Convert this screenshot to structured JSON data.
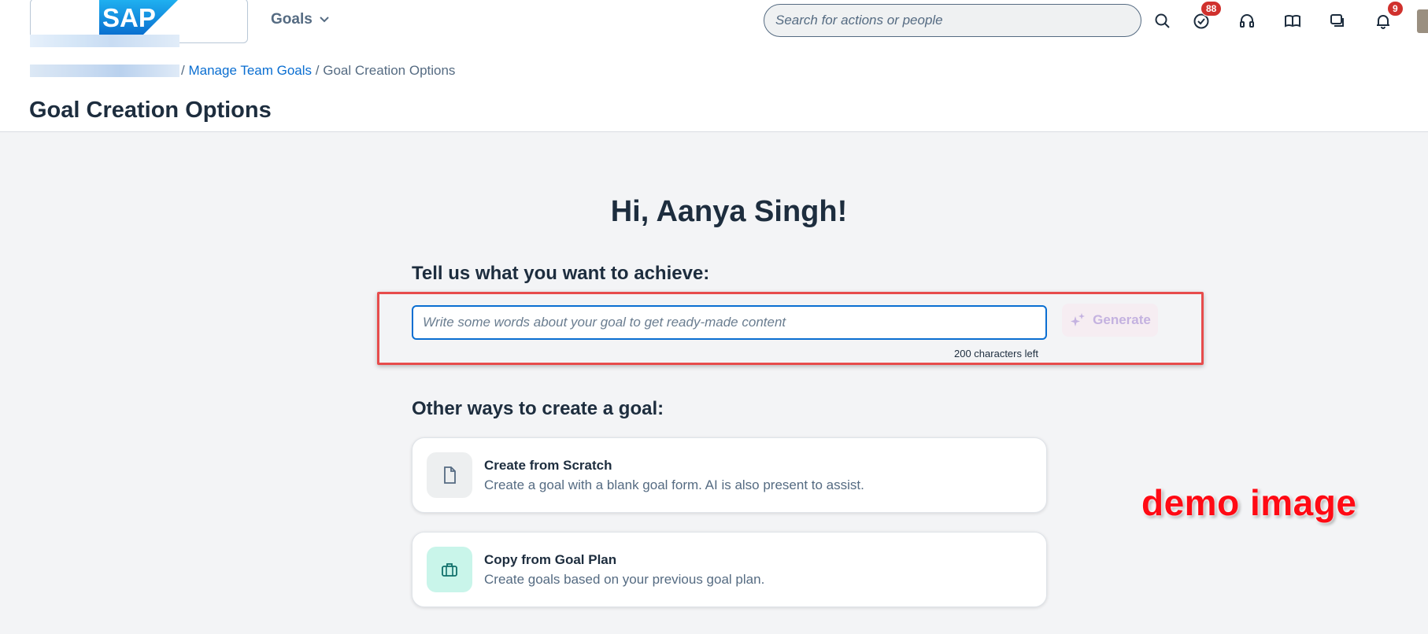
{
  "header": {
    "logo_text": "SAP",
    "app_menu_label": "Goals",
    "search": {
      "placeholder": "Search for actions or people",
      "value": ""
    },
    "icons": [
      {
        "name": "search-icon"
      },
      {
        "name": "tasks-icon",
        "badge": "88"
      },
      {
        "name": "support-icon"
      },
      {
        "name": "learning-icon"
      },
      {
        "name": "feedback-icon"
      },
      {
        "name": "notifications-icon",
        "badge": "9"
      }
    ]
  },
  "breadcrumb": {
    "link_label": "Manage Team Goals",
    "separator": "/",
    "current": "Goal Creation Options"
  },
  "page_title": "Goal Creation Options",
  "main": {
    "greeting": "Hi, Aanya Singh!",
    "prompt_label": "Tell us what you want to achieve:",
    "goal_input": {
      "placeholder": "Write some words about your goal to get ready-made content",
      "value": ""
    },
    "generate_label": "Generate",
    "char_counter": "200 characters left",
    "other_ways_label": "Other ways to create a goal:",
    "options": [
      {
        "title": "Create from Scratch",
        "description": "Create a goal with a blank goal form. AI is also present to assist.",
        "icon": "document-icon"
      },
      {
        "title": "Copy from Goal Plan",
        "description": "Create goals based on your previous goal plan.",
        "icon": "briefcase-icon"
      }
    ]
  },
  "watermark": "demo image",
  "colors": {
    "accent": "#0a6ed1",
    "badge": "#d0312d",
    "highlight_frame": "#e74c4c",
    "watermark": "#ff0a14"
  }
}
